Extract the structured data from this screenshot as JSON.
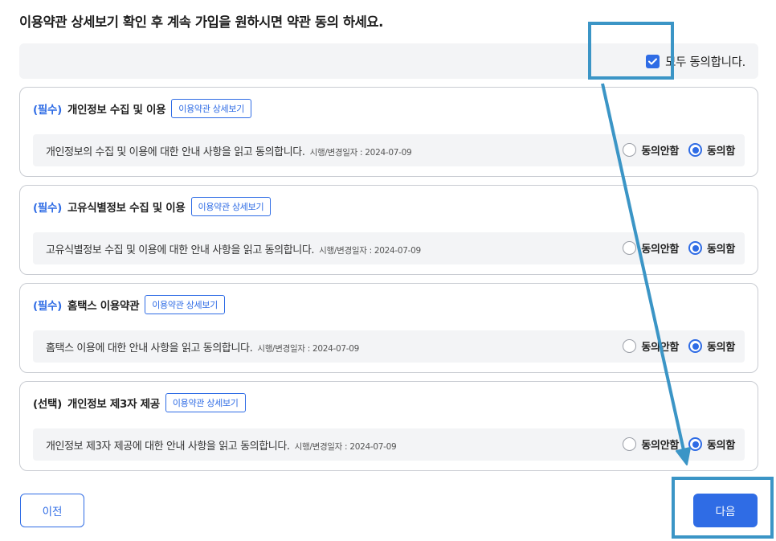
{
  "page": {
    "title": "이용약관 상세보기 확인 후 계속 가입을 원하시면 약관 동의 하세요."
  },
  "agree_all": {
    "label": "모두 동의합니다.",
    "checked": true
  },
  "terms": [
    {
      "tag": "(필수)",
      "title": "개인정보 수집 및 이용",
      "detail_label": "이용약관 상세보기",
      "description": "개인정보의 수집 및 이용에 대한 안내 사항을 읽고 동의합니다.",
      "date_text": "시행/변경일자 : 2024-07-09",
      "disagree_label": "동의안함",
      "agree_label": "동의함",
      "selected": "agree"
    },
    {
      "tag": "(필수)",
      "title": "고유식별정보 수집 및 이용",
      "detail_label": "이용약관 상세보기",
      "description": "고유식별정보 수집 및 이용에 대한 안내 사항을 읽고 동의합니다.",
      "date_text": "시행/변경일자 : 2024-07-09",
      "disagree_label": "동의안함",
      "agree_label": "동의함",
      "selected": "agree"
    },
    {
      "tag": "(필수)",
      "title": "홈택스 이용약관",
      "detail_label": "이용약관 상세보기",
      "description": "홈택스 이용에 대한 안내 사항을 읽고 동의합니다.",
      "date_text": "시행/변경일자 : 2024-07-09",
      "disagree_label": "동의안함",
      "agree_label": "동의함",
      "selected": "agree"
    },
    {
      "tag": "(선택)",
      "title": "개인정보 제3자 제공",
      "detail_label": "이용약관 상세보기",
      "description": "개인정보 제3자 제공에 대한 안내 사항을 읽고 동의합니다.",
      "date_text": "시행/변경일자 : 2024-07-09",
      "disagree_label": "동의안함",
      "agree_label": "동의함",
      "selected": "agree"
    }
  ],
  "buttons": {
    "prev_label": "이전",
    "next_label": "다음"
  },
  "colors": {
    "accent": "#2f6ce5",
    "annotation": "#3b95c6"
  },
  "icons": {
    "checkbox": "check-icon"
  }
}
